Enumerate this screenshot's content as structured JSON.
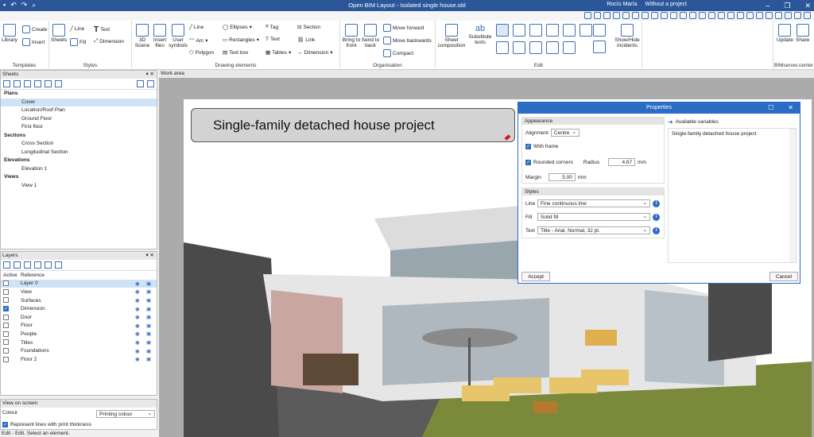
{
  "window": {
    "title": "Open BIM Layout - Isolated single house.obl",
    "user": "Rocío María",
    "project": "Without a project"
  },
  "ribbon": {
    "templates": {
      "name": "Templates",
      "library": "Library",
      "create": "Create",
      "insert": "Insert"
    },
    "styles": {
      "name": "Styles",
      "sheets": "Sheets",
      "line": "Line",
      "fill": "Fill",
      "text": "Text",
      "dimension": "Dimension"
    },
    "drawing": {
      "name": "Drawing elements",
      "scene": "3D Scene",
      "insert_files": "Insert files",
      "user_symbols": "User symbols",
      "line": "Line",
      "arc": "Arc",
      "polygon": "Polygon",
      "ellipses": "Ellipses",
      "rectangles": "Rectangles",
      "text_box": "Text box",
      "tag": "Tag",
      "text": "Text",
      "tables": "Tables",
      "section": "Section",
      "link": "Link",
      "dimension": "Dimension"
    },
    "organisation": {
      "name": "Organisation",
      "bring_front": "Bring to front",
      "send_back": "Send to back",
      "move_forward": "Move forward",
      "move_backwards": "Move backwards",
      "compact": "Compact"
    },
    "edit": {
      "name": "Edit",
      "sheet_composition": "Sheet composition",
      "substitute_texts": "Substitute texts",
      "show_hide_incidents": "Show/Hide incidents"
    },
    "bimserver": {
      "name": "BIMserver.center",
      "update": "Update",
      "share": "Share"
    }
  },
  "sheets": {
    "title": "Sheets",
    "tree": [
      {
        "label": "Plans",
        "level": 0
      },
      {
        "label": "Cover",
        "level": 1,
        "selected": true
      },
      {
        "label": "Location/Roof Plan",
        "level": 1
      },
      {
        "label": "Ground Floor",
        "level": 1
      },
      {
        "label": "First floor",
        "level": 1
      },
      {
        "label": "Sections",
        "level": 0
      },
      {
        "label": "Cross Section",
        "level": 1
      },
      {
        "label": "Longitudinal Section",
        "level": 1
      },
      {
        "label": "Elevations",
        "level": 0
      },
      {
        "label": "Elevation 1",
        "level": 1
      },
      {
        "label": "Views",
        "level": 0
      },
      {
        "label": "View 1",
        "level": 1
      }
    ]
  },
  "layers": {
    "title": "Layers",
    "col_active": "Active",
    "col_reference": "Reference",
    "rows": [
      {
        "name": "Layer 0",
        "active": false,
        "selected": true
      },
      {
        "name": "View",
        "active": false
      },
      {
        "name": "Surfaces",
        "active": false
      },
      {
        "name": "Dimension",
        "active": true
      },
      {
        "name": "Door",
        "active": false
      },
      {
        "name": "Floor",
        "active": false
      },
      {
        "name": "People",
        "active": false
      },
      {
        "name": "Titles",
        "active": false
      },
      {
        "name": "Foundations",
        "active": false
      },
      {
        "name": "Floor 2",
        "active": false
      }
    ]
  },
  "view_on_screen": {
    "title": "View on screen",
    "colour_label": "Colour",
    "colour_value": "Printing colour",
    "represent_lines": "Represent lines with print thickness"
  },
  "status": "Edit - Edit. Select an element.",
  "work_area": {
    "title": "Work area",
    "banner": "Single-family detached house project"
  },
  "properties": {
    "title": "Properties",
    "appearance": "Appearance",
    "alignment_label": "Alignment",
    "alignment_value": "Centre",
    "with_frame": "With frame",
    "rounded_corners": "Rounded corners",
    "radius_label": "Radius",
    "radius_value": "4.67",
    "radius_unit": "mm",
    "margin_label": "Margin",
    "margin_value": "5.00",
    "margin_unit": "mm",
    "styles": "Styles",
    "line_label": "Line",
    "line_value": "Fine continuous line",
    "fill_label": "Fill",
    "fill_value": "Solid fill",
    "text_label": "Text",
    "text_value": "Title - Arial, Normal, 32 pt.",
    "available_variables": "Available variables",
    "variable_text": "Single-family detached house project",
    "accept": "Accept",
    "cancel": "Cancel"
  }
}
